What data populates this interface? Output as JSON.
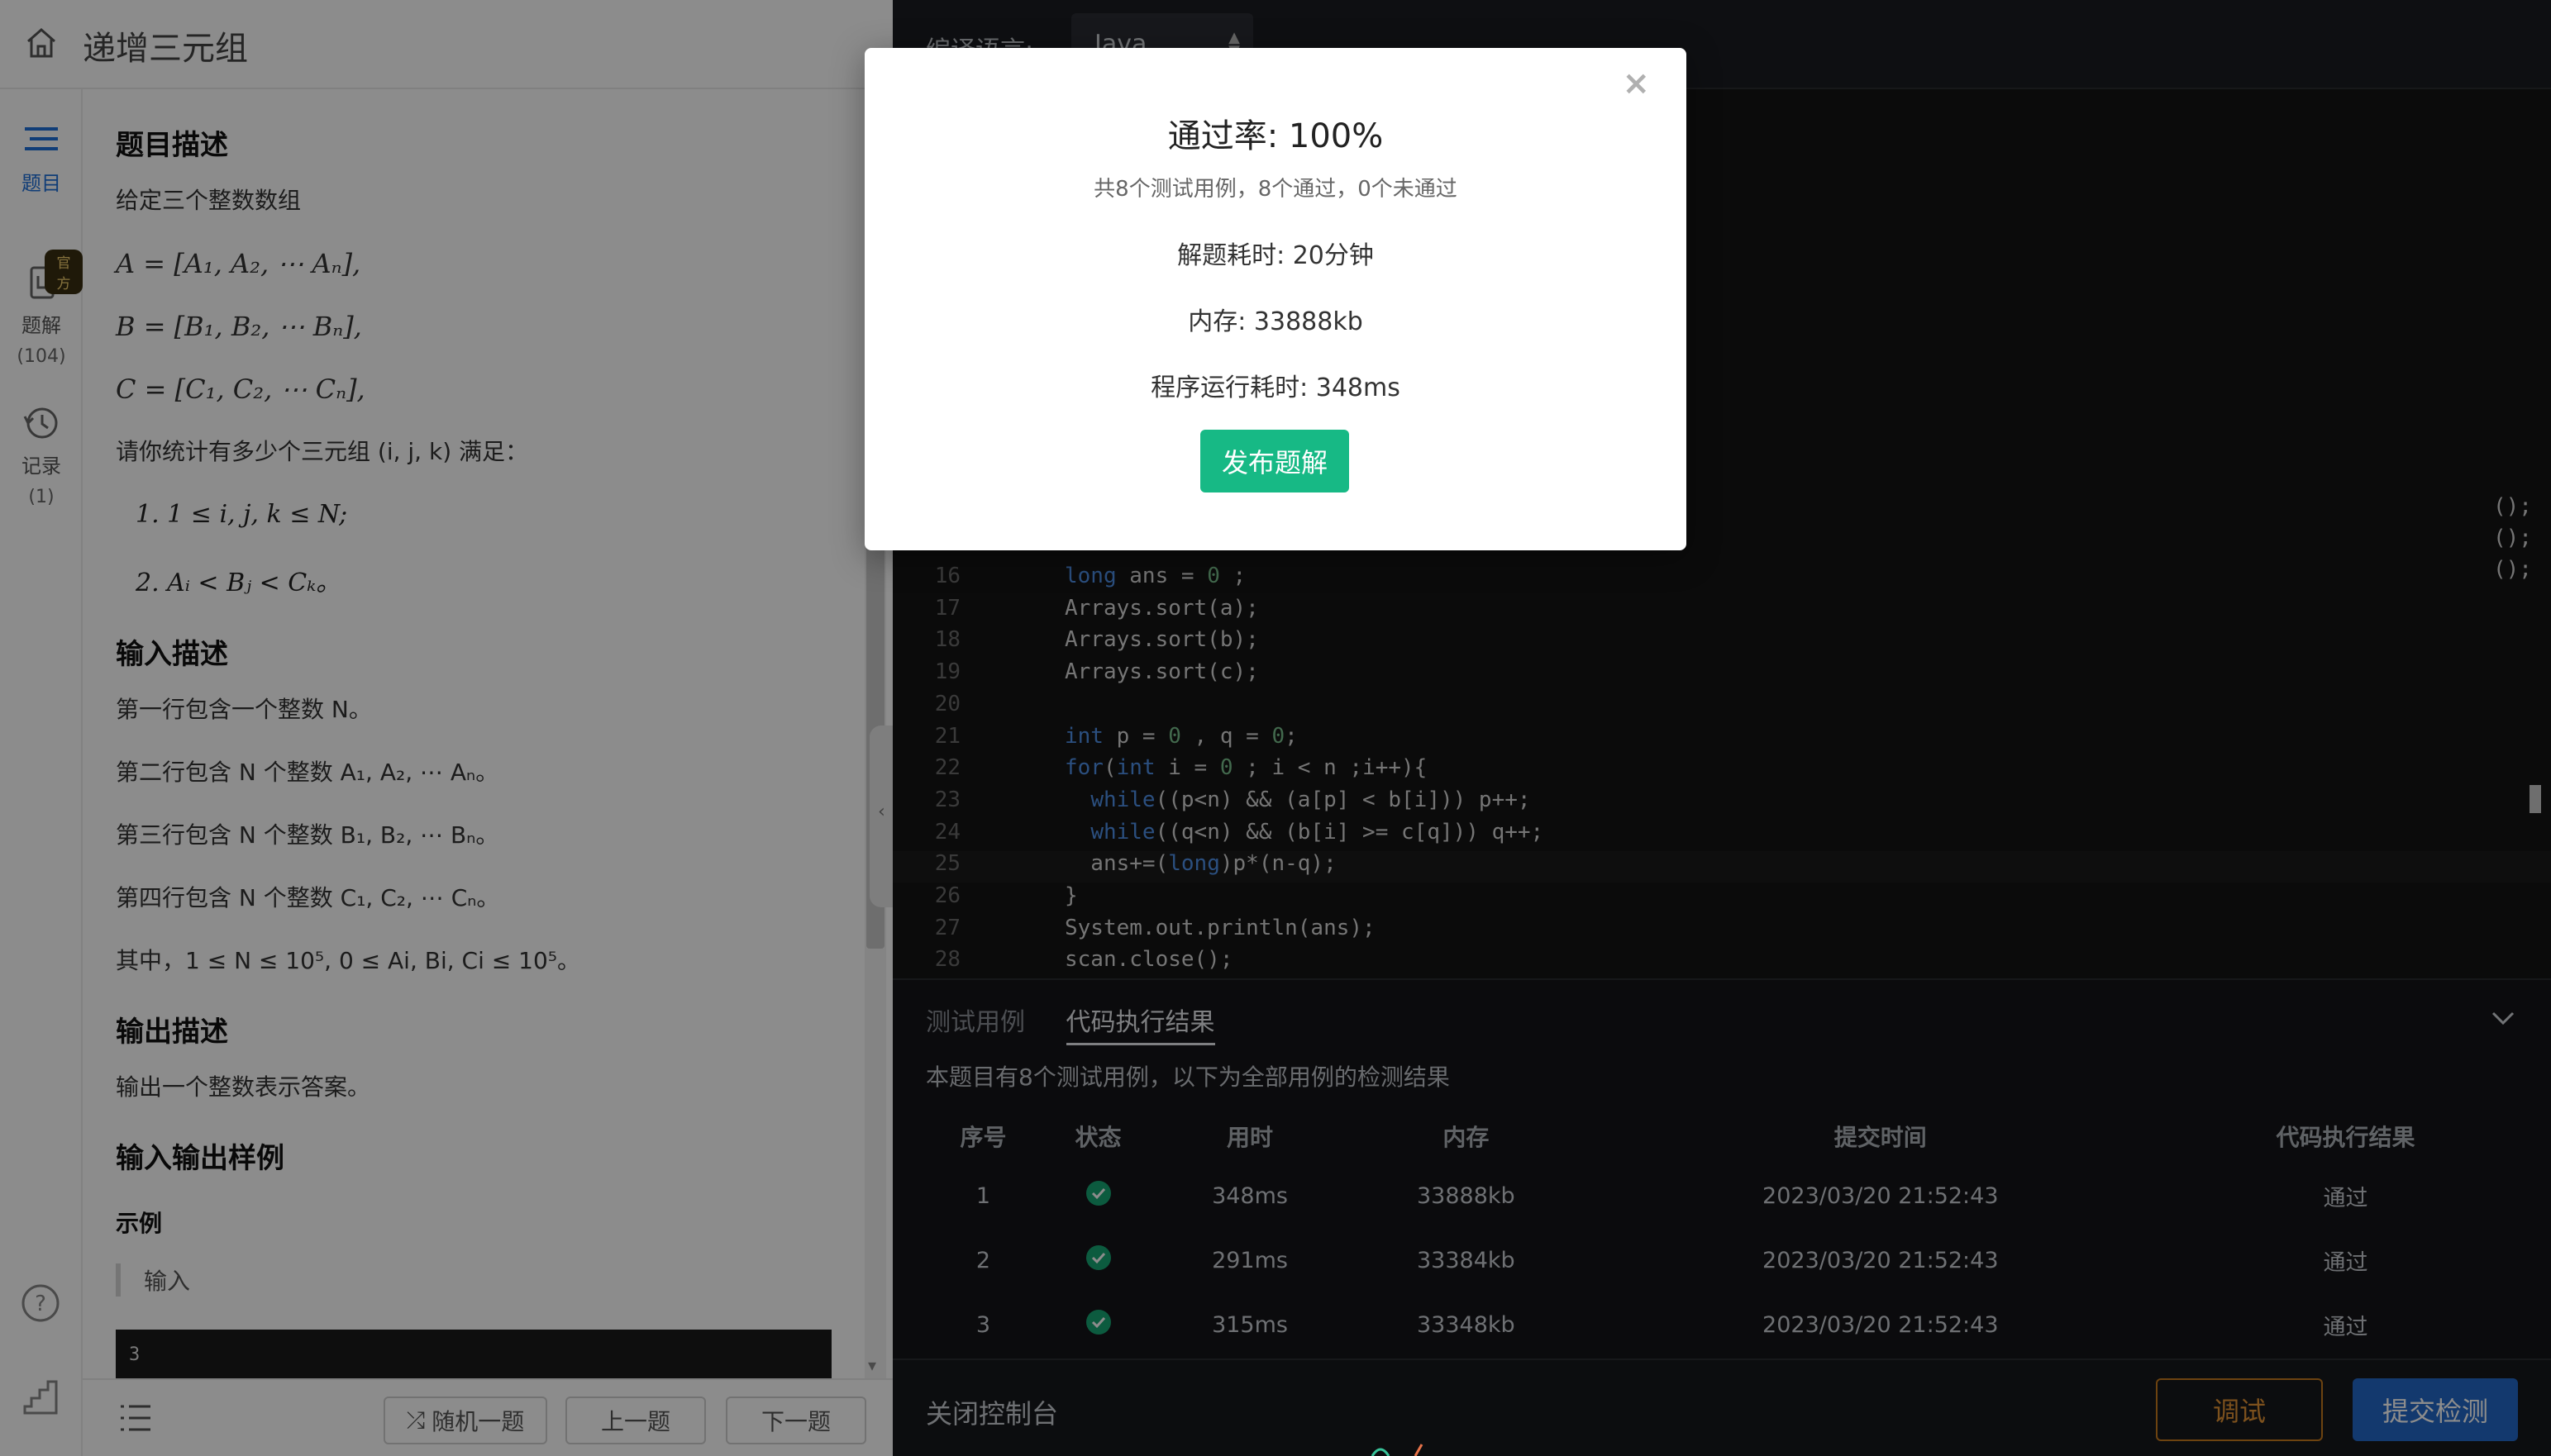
{
  "header": {
    "title": "递增三元组"
  },
  "rail": {
    "problem_label": "题目",
    "solution_label": "题解",
    "solution_count": "(104)",
    "official_badge": "官方",
    "record_label": "记录",
    "record_count": "(1)"
  },
  "problem": {
    "desc_heading": "题目描述",
    "intro": "给定三个整数数组",
    "eq_a": "A = [A₁, A₂, ⋯ Aₙ],",
    "eq_b": "B = [B₁, B₂, ⋯ Bₙ],",
    "eq_c": "C = [C₁, C₂, ⋯ Cₙ],",
    "question": "请你统计有多少个三元组 (i, j, k) 满足：",
    "cond1": "1. 1 ≤ i, j, k ≤ N;",
    "cond2": "2. Aᵢ < Bⱼ < Cₖ。",
    "input_heading": "输入描述",
    "input1": "第一行包含一个整数 N。",
    "input2": "第二行包含 N 个整数 A₁, A₂, ⋯ Aₙ。",
    "input3": "第三行包含 N 个整数 B₁, B₂, ⋯ Bₙ。",
    "input4": "第四行包含 N 个整数 C₁, C₂, ⋯ Cₙ。",
    "constraint": "其中，1 ≤ N ≤ 10⁵, 0 ≤ Ai, Bi, Ci ≤ 10⁵。",
    "output_heading": "输出描述",
    "output_desc": "输出一个整数表示答案。",
    "sample_heading": "输入输出样例",
    "example_heading": "示例",
    "input_label": "输入",
    "sample_input": "3"
  },
  "footer_left": {
    "random": "随机一题",
    "prev": "上一题",
    "next": "下一题"
  },
  "toolbar": {
    "lang_label": "编译语言:",
    "lang_value": "Java"
  },
  "code_lines": [
    {
      "n": "16",
      "text": "long ans = 0 ;"
    },
    {
      "n": "17",
      "text": "Arrays.sort(a);"
    },
    {
      "n": "18",
      "text": "Arrays.sort(b);"
    },
    {
      "n": "19",
      "text": "Arrays.sort(c);"
    },
    {
      "n": "20",
      "text": ""
    },
    {
      "n": "21",
      "text": "int p = 0 , q = 0;"
    },
    {
      "n": "22",
      "text": "for(int i = 0 ; i < n ;i++){"
    },
    {
      "n": "23",
      "text": "  while((p<n) && (a[p] < b[i])) p++;"
    },
    {
      "n": "24",
      "text": "  while((q<n) && (b[i] >= c[q])) q++;"
    },
    {
      "n": "25",
      "text": "  ans+=(long)p*(n-q);"
    },
    {
      "n": "26",
      "text": "}"
    },
    {
      "n": "27",
      "text": "System.out.println(ans);"
    },
    {
      "n": "28",
      "text": "scan.close();"
    }
  ],
  "code_tails": [
    "();",
    "();",
    "();"
  ],
  "console": {
    "tab_tests": "测试用例",
    "tab_results": "代码执行结果",
    "desc": "本题目有8个测试用例，以下为全部用例的检测结果",
    "headers": [
      "序号",
      "状态",
      "用时",
      "内存",
      "提交时间",
      "代码执行结果"
    ],
    "rows": [
      {
        "id": "1",
        "time": "348ms",
        "mem": "33888kb",
        "submitted": "2023/03/20 21:52:43",
        "result": "通过"
      },
      {
        "id": "2",
        "time": "291ms",
        "mem": "33384kb",
        "submitted": "2023/03/20 21:52:43",
        "result": "通过"
      },
      {
        "id": "3",
        "time": "315ms",
        "mem": "33348kb",
        "submitted": "2023/03/20 21:52:43",
        "result": "通过"
      }
    ]
  },
  "footer_right": {
    "close_console": "关闭控制台",
    "debug": "调试",
    "submit": "提交检测"
  },
  "modal": {
    "close": "×",
    "pass_rate": "通过率: 100%",
    "summary": "共8个测试用例，8个通过，0个未通过",
    "solve_time": "解题耗时: 20分钟",
    "memory": "内存: 33888kb",
    "run_time": "程序运行耗时: 348ms",
    "publish": "发布题解"
  },
  "colors": {
    "accent": "#1e6fd9",
    "success": "#17b985",
    "warning": "#c77a1e",
    "submit": "#2468c8"
  }
}
